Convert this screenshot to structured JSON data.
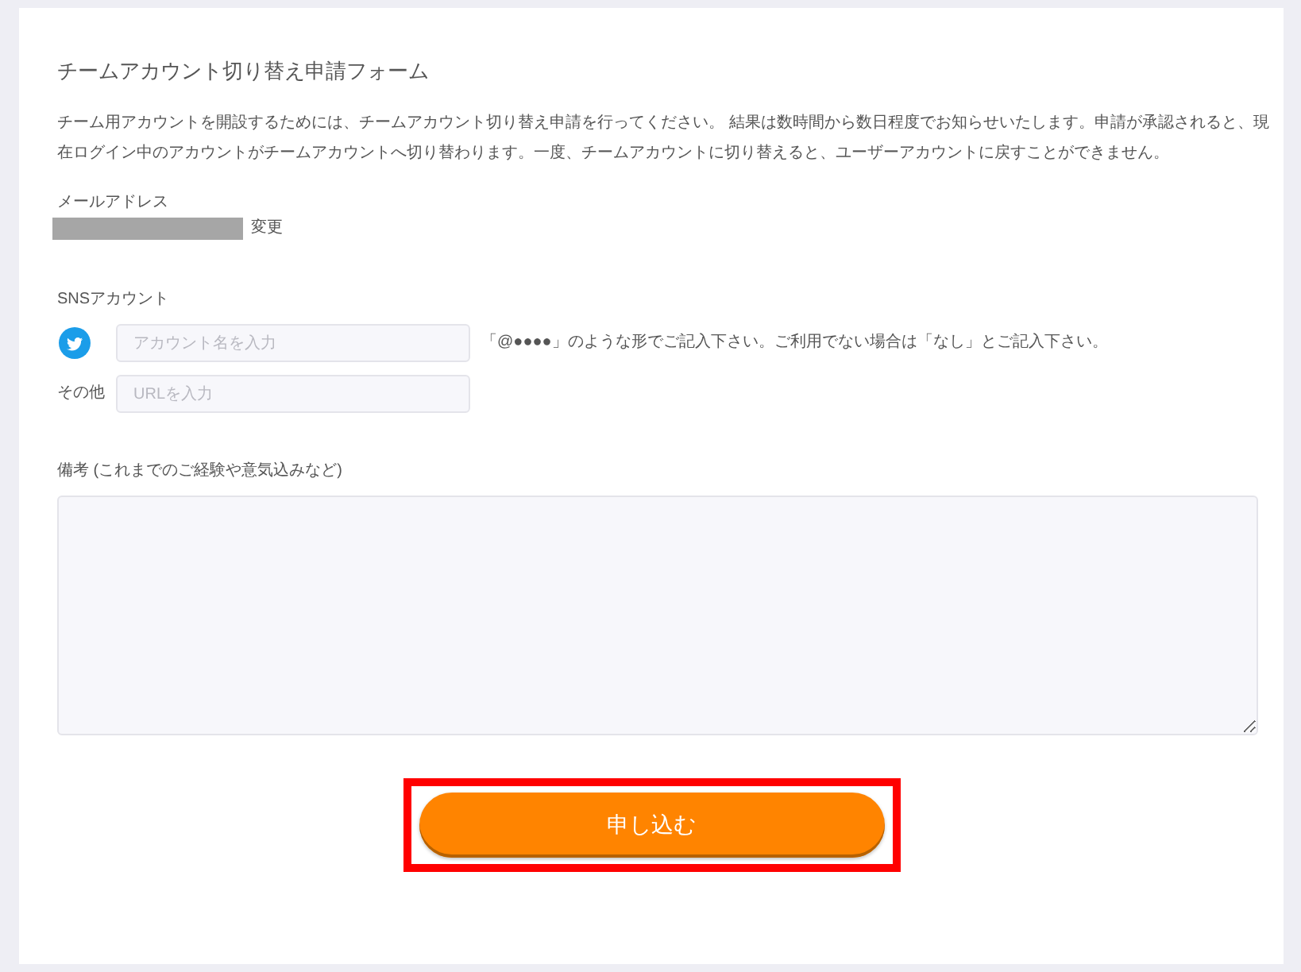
{
  "form": {
    "title": "チームアカウント切り替え申請フォーム",
    "description": "チーム用アカウントを開設するためには、チームアカウント切り替え申請を行ってください。 結果は数時間から数日程度でお知らせいたします。申請が承認されると、現在ログイン中のアカウントがチームアカウントへ切り替わります。一度、チームアカウントに切り替えると、ユーザーアカウントに戻すことができません。"
  },
  "email": {
    "label": "メールアドレス",
    "value_redacted": true,
    "change_link": "変更"
  },
  "sns": {
    "label": "SNSアカウント",
    "fields": [
      {
        "kind": "twitter",
        "placeholder": "アカウント名を入力",
        "hint": "「@●●●●」のような形でご記入下さい。ご利用でない場合は「なし」とご記入下さい。"
      },
      {
        "kind": "other",
        "label": "その他",
        "placeholder": "URLを入力"
      }
    ]
  },
  "remarks": {
    "label": "備考 (これまでのご経験や意気込みなど)"
  },
  "submit": {
    "label": "申し込む",
    "highlighted": true
  }
}
